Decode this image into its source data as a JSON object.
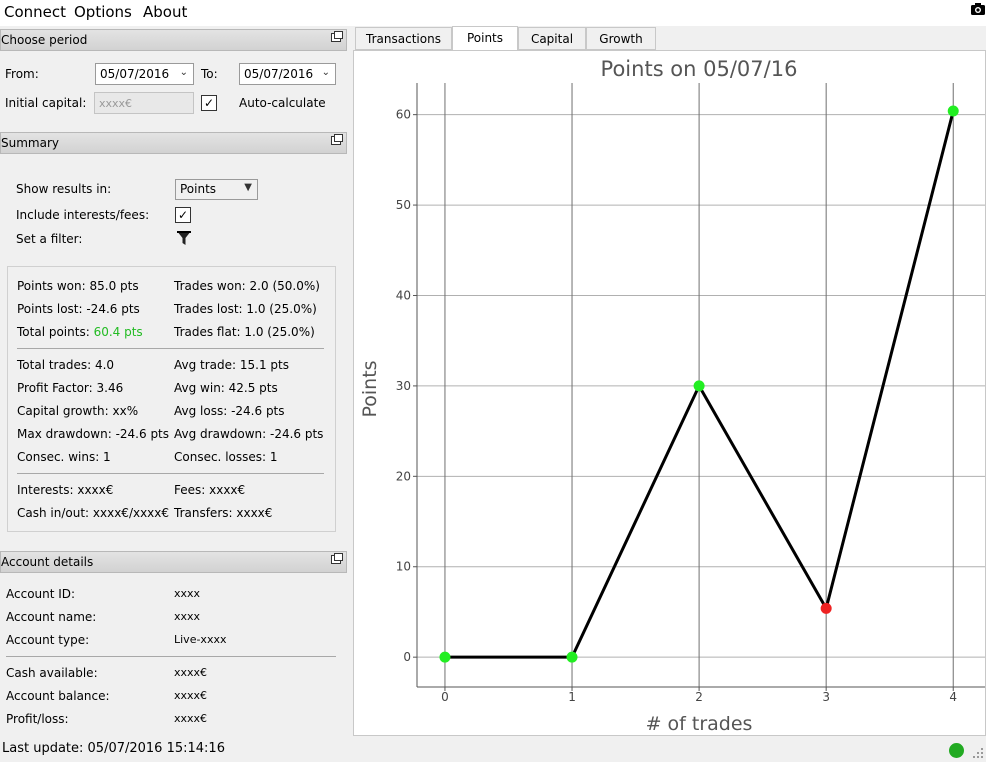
{
  "menu": {
    "connect": "Connect",
    "options": "Options",
    "about": "About"
  },
  "period": {
    "title": "Choose period",
    "from_label": "From:",
    "from_value": "05/07/2016",
    "to_label": "To:",
    "to_value": "05/07/2016",
    "capital_label": "Initial capital:",
    "capital_placeholder": "xxxx€",
    "auto_label": "Auto-calculate",
    "auto_checked": true
  },
  "summary": {
    "title": "Summary",
    "show_label": "Show results in:",
    "show_value": "Points",
    "include_label": "Include interests/fees:",
    "include_checked": true,
    "filter_label": "Set a filter:",
    "points_won": "Points won: 85.0 pts",
    "trades_won": "Trades won: 2.0 (50.0%)",
    "points_lost": "Points lost: -24.6 pts",
    "trades_lost": "Trades lost: 1.0 (25.0%)",
    "total_points_label": "Total points:",
    "total_points_value": "60.4 pts",
    "trades_flat": "Trades flat: 1.0 (25.0%)",
    "total_trades": "Total trades: 4.0",
    "avg_trade": "Avg trade: 15.1 pts",
    "profit_factor": "Profit Factor: 3.46",
    "avg_win": "Avg win: 42.5 pts",
    "capital_growth": "Capital growth: xx%",
    "avg_loss": "Avg loss: -24.6 pts",
    "max_drawdown": "Max drawdown: -24.6 pts",
    "avg_drawdown": "Avg drawdown: -24.6 pts",
    "consec_wins": "Consec. wins: 1",
    "consec_losses": "Consec. losses: 1",
    "interests": "Interests: xxxx€",
    "fees": "Fees: xxxx€",
    "cash_inout": "Cash in/out: xxxx€/xxxx€",
    "transfers": "Transfers: xxxx€"
  },
  "account": {
    "title": "Account details",
    "id_label": "Account ID:",
    "id_value": "xxxx",
    "name_label": "Account name:",
    "name_value": "xxxx",
    "type_label": "Account type:",
    "type_value": "Live-xxxx",
    "cash_label": "Cash available:",
    "cash_value": "xxxx€",
    "balance_label": "Account balance:",
    "balance_value": "xxxx€",
    "pl_label": "Profit/loss:",
    "pl_value": "xxxx€"
  },
  "tabs": [
    "Transactions",
    "Points",
    "Capital",
    "Growth"
  ],
  "active_tab": 1,
  "status": {
    "last_update": "Last update: 05/07/2016 15:14:16",
    "connection_color": "#22aa22"
  },
  "colors": {
    "win": "#22ee22",
    "loss": "#ee2222",
    "total_points": "#22bb22"
  },
  "chart_data": {
    "type": "line",
    "title": "Points on 05/07/16",
    "xlabel": "# of trades",
    "ylabel": "Points",
    "x": [
      0,
      1,
      2,
      3,
      4
    ],
    "values": [
      0,
      0,
      30,
      5.4,
      60.4
    ],
    "point_status": [
      "win",
      "win",
      "win",
      "loss",
      "win"
    ],
    "xlim": [
      -0.22,
      4.25
    ],
    "ylim": [
      -3.3,
      63.5
    ],
    "xticks": [
      0,
      1,
      2,
      3,
      4
    ],
    "yticks": [
      0,
      10,
      20,
      30,
      40,
      50,
      60
    ],
    "grid": true,
    "line_color": "#000000"
  }
}
